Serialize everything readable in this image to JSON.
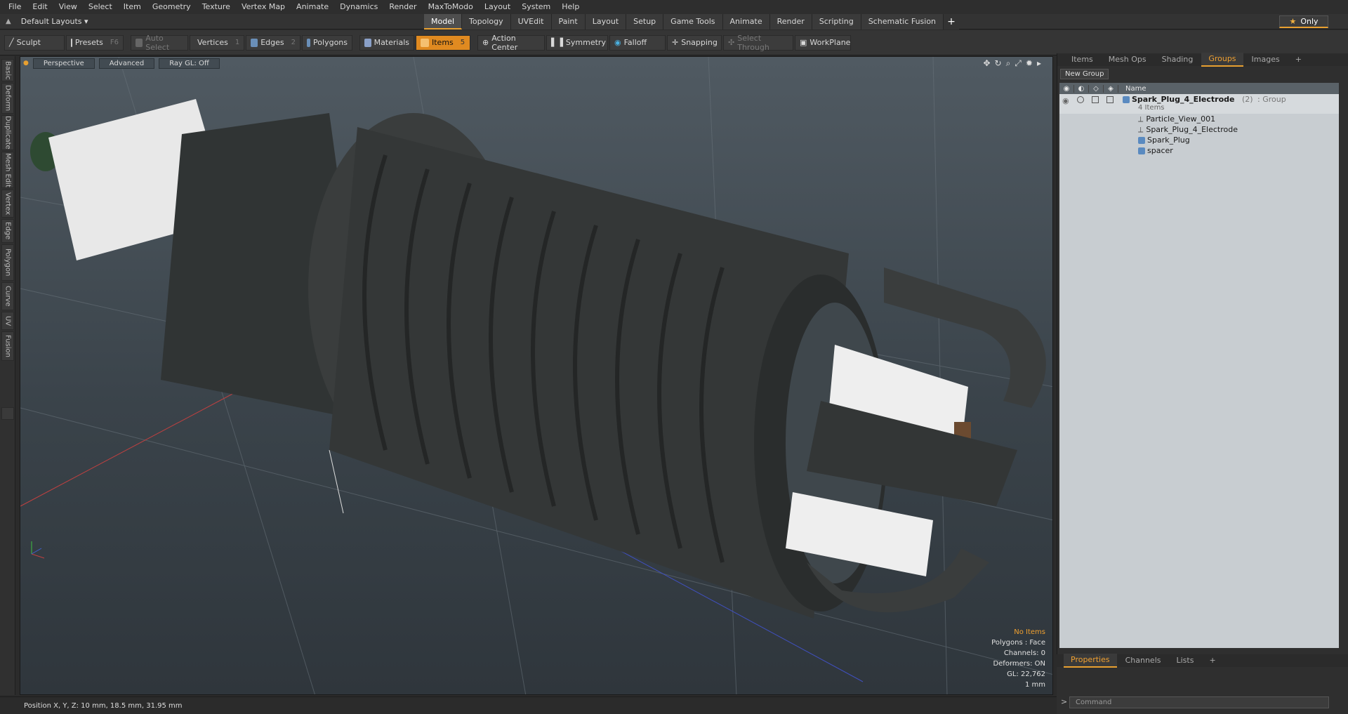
{
  "menu": [
    "File",
    "Edit",
    "View",
    "Select",
    "Item",
    "Geometry",
    "Texture",
    "Vertex Map",
    "Animate",
    "Dynamics",
    "Render",
    "MaxToModo",
    "Layout",
    "System",
    "Help"
  ],
  "layout_selector": "Default Layouts ▾",
  "layout_tabs": [
    "Model",
    "Topology",
    "UVEdit",
    "Paint",
    "Layout",
    "Setup",
    "Game Tools",
    "Animate",
    "Render",
    "Scripting",
    "Schematic Fusion"
  ],
  "active_layout_tab": "Model",
  "only_label": "Only",
  "toolbar": {
    "sculpt": "Sculpt",
    "presets": "Presets",
    "presets_key": "F6",
    "auto_select": "Auto Select",
    "vertices": "Vertices",
    "vertices_key": "1",
    "edges": "Edges",
    "edges_key": "2",
    "polygons": "Polygons",
    "materials": "Materials",
    "items": "Items",
    "items_key": "5",
    "action_center": "Action Center",
    "symmetry": "Symmetry",
    "falloff": "Falloff",
    "snapping": "Snapping",
    "select_through": "Select Through",
    "workplane": "WorkPlane"
  },
  "left_tabs": [
    "Basic",
    "Deform",
    "Duplicate",
    "Mesh Edit",
    "Vertex",
    "Edge",
    "Polygon",
    "Curve",
    "UV",
    "Fusion"
  ],
  "viewport": {
    "view": "Perspective",
    "advanced": "Advanced",
    "raygl": "Ray GL: Off",
    "info": {
      "items": "No Items",
      "polygons": "Polygons : Face",
      "channels": "Channels: 0",
      "deformers": "Deformers: ON",
      "gl": "GL: 22,762",
      "scale": "1 mm"
    }
  },
  "status": {
    "position": "Position X, Y, Z:   10 mm, 18.5 mm, 31.95 mm"
  },
  "right_panel": {
    "tabs": [
      "Items",
      "Mesh Ops",
      "Shading",
      "Groups",
      "Images"
    ],
    "active_tab": "Groups",
    "new_group": "New Group",
    "name_col": "Name",
    "group": {
      "name": "Spark_Plug_4_Electrode",
      "count": "(2)",
      "type": ": Group",
      "sub": "4 Items"
    },
    "children": [
      "Particle_View_001",
      "Spark_Plug_4_Electrode",
      "Spark_Plug",
      "spacer"
    ]
  },
  "bottom_panel": {
    "tabs": [
      "Properties",
      "Channels",
      "Lists"
    ],
    "active_tab": "Properties",
    "command_placeholder": "Command"
  }
}
